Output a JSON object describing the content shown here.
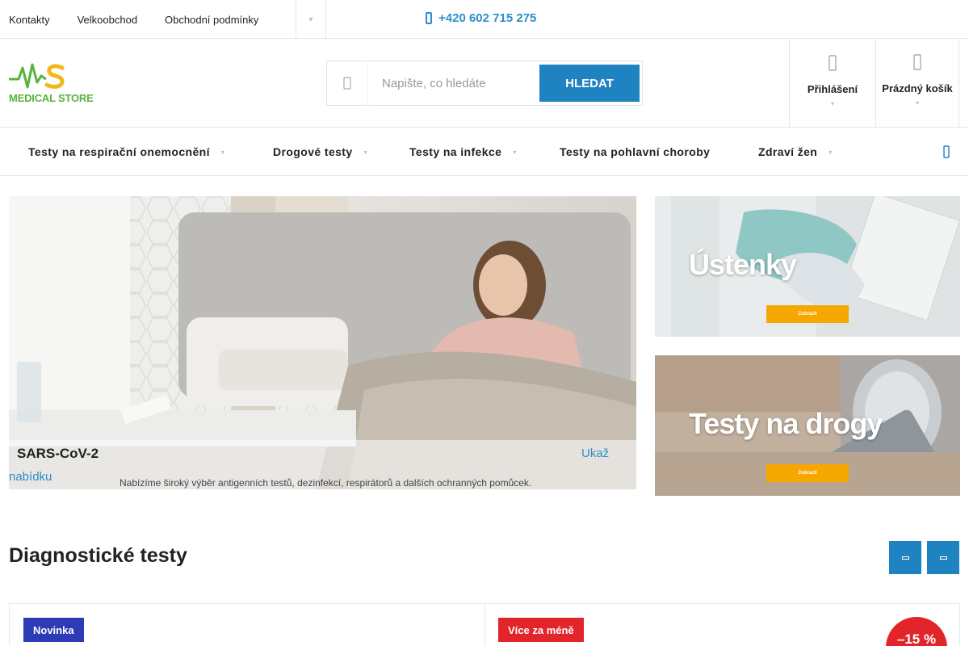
{
  "topbar": {
    "links": [
      "Kontakty",
      "Velkoobchod",
      "Obchodní podmínky"
    ],
    "phone": "+420 602 715 275"
  },
  "logo": {
    "text": "MEDICAL STORE"
  },
  "search": {
    "placeholder": "Napište, co hledáte",
    "button": "HLEDAT"
  },
  "header": {
    "login_label": "Přihlášení",
    "cart_label": "Prázdný košík"
  },
  "nav": {
    "items": [
      "Testy na respirační onemocnění",
      "Drogové testy",
      "Testy na infekce",
      "Testy na pohlavní choroby",
      "Zdraví žen"
    ]
  },
  "hero": {
    "title": "SARS-CoV-2",
    "more_part1": "Ukaž",
    "more_part2": "nabídku",
    "description": "Nabízíme široký výběr antigenních testů, dezinfekcí, respirátorů a dalších ochranných pomůcek."
  },
  "banners": [
    {
      "title": "Ústenky",
      "button": "Zobrazit"
    },
    {
      "title": "Testy na drogy",
      "button": "Zobrazit"
    }
  ],
  "section": {
    "title": "Diagnostické testy"
  },
  "products": [
    {
      "flag": "Novinka",
      "flag_color": "#2d3bb5"
    },
    {
      "flag": "Více za méně",
      "flag_color": "#e2252a",
      "discount": "–15 %"
    }
  ],
  "colors": {
    "accent": "#1f82c1",
    "link": "#2b8fc8",
    "brand_green": "#58b33f",
    "brand_yellow": "#f0b81a"
  }
}
